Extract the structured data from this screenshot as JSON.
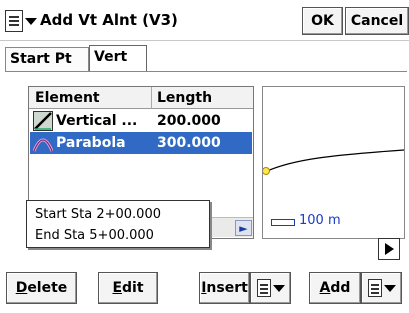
{
  "window": {
    "title": "Add Vt Alnt (V3)",
    "ok_label": "OK",
    "cancel_label": "Cancel"
  },
  "tabs": [
    {
      "label": "Start Pt",
      "active": false
    },
    {
      "label": "Vert",
      "active": true
    }
  ],
  "table": {
    "columns": [
      "Element",
      "Length"
    ],
    "rows": [
      {
        "element": "Vertical ...",
        "length": "200.000",
        "icon": "grade-line-icon"
      },
      {
        "element": "Parabola",
        "length": "300.000",
        "icon": "parabola-icon",
        "selected": true
      }
    ]
  },
  "popup": {
    "line1": "Start Sta 2+00.000",
    "line2": "End Sta 5+00.000"
  },
  "status_partial": "End Sta 5+00.000",
  "preview": {
    "scale_label": "100 m",
    "line_color": "#000000",
    "marker_color": "#e8c000"
  },
  "buttons": {
    "delete": {
      "prefix": "",
      "underline": "D",
      "rest": "elete"
    },
    "edit": {
      "prefix": "",
      "underline": "E",
      "rest": "dit"
    },
    "insert": {
      "prefix": "",
      "underline": "I",
      "rest": "nsert"
    },
    "add": {
      "prefix": "",
      "underline": "A",
      "rest": "dd"
    }
  },
  "colors": {
    "selection": "#316ac5",
    "scale": "#1a3dbf"
  }
}
